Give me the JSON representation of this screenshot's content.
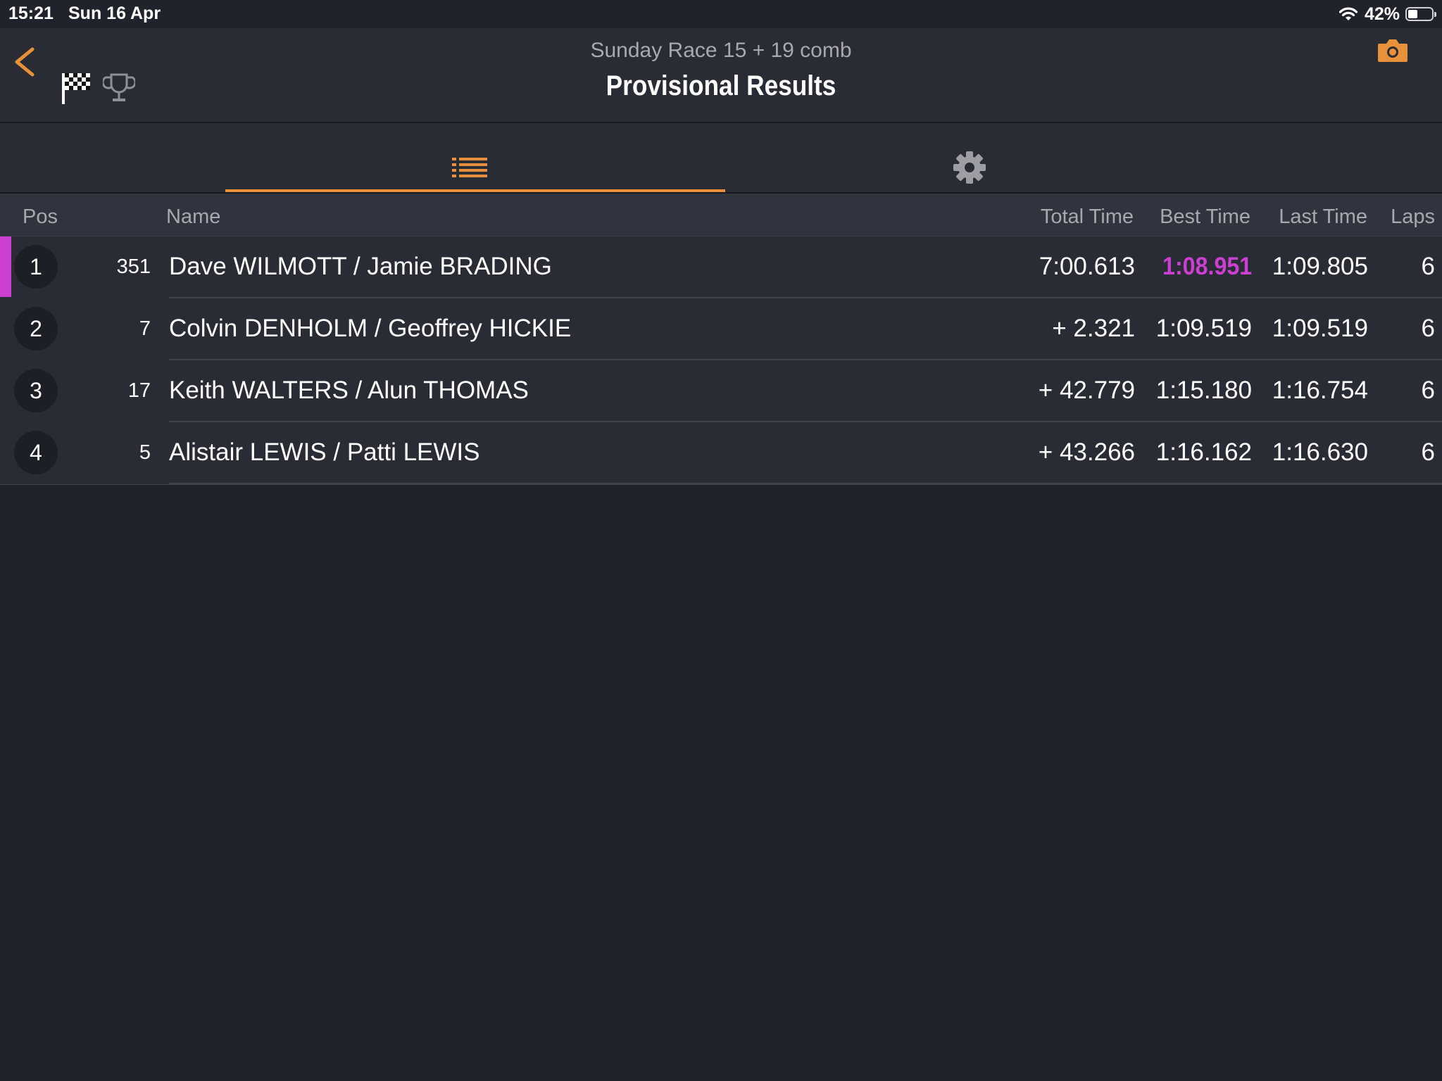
{
  "status_bar": {
    "time": "15:21",
    "date": "Sun 16 Apr",
    "battery": "42%",
    "battery_level": 0.42
  },
  "header": {
    "subtitle": "Sunday Race 15 + 19 comb",
    "title": "Provisional Results"
  },
  "icons": {
    "back": "chevron-left-icon",
    "flag": "checkered-flag-icon",
    "trophy": "trophy-icon",
    "camera": "camera-icon",
    "list": "list-icon",
    "settings": "gear-icon"
  },
  "tabs": {
    "active": "list"
  },
  "columns": {
    "pos": "Pos",
    "name": "Name",
    "total": "Total Time",
    "best": "Best Time",
    "last": "Last Time",
    "laps": "Laps"
  },
  "colors": {
    "accent": "#e8913a",
    "fastest": "#cc3fd0",
    "background": "#20232b",
    "panel": "#292c35"
  },
  "rows": [
    {
      "pos": "1",
      "number": "351",
      "name": "Dave WILMOTT / Jamie BRADING",
      "total": "7:00.613",
      "best": "1:08.951",
      "last": "1:09.805",
      "laps": "6",
      "fastest_lap": true
    },
    {
      "pos": "2",
      "number": "7",
      "name": "Colvin DENHOLM / Geoffrey HICKIE",
      "total": "+ 2.321",
      "best": "1:09.519",
      "last": "1:09.519",
      "laps": "6",
      "fastest_lap": false
    },
    {
      "pos": "3",
      "number": "17",
      "name": "Keith WALTERS / Alun THOMAS",
      "total": "+ 42.779",
      "best": "1:15.180",
      "last": "1:16.754",
      "laps": "6",
      "fastest_lap": false
    },
    {
      "pos": "4",
      "number": "5",
      "name": "Alistair LEWIS / Patti LEWIS",
      "total": "+ 43.266",
      "best": "1:16.162",
      "last": "1:16.630",
      "laps": "6",
      "fastest_lap": false
    }
  ]
}
